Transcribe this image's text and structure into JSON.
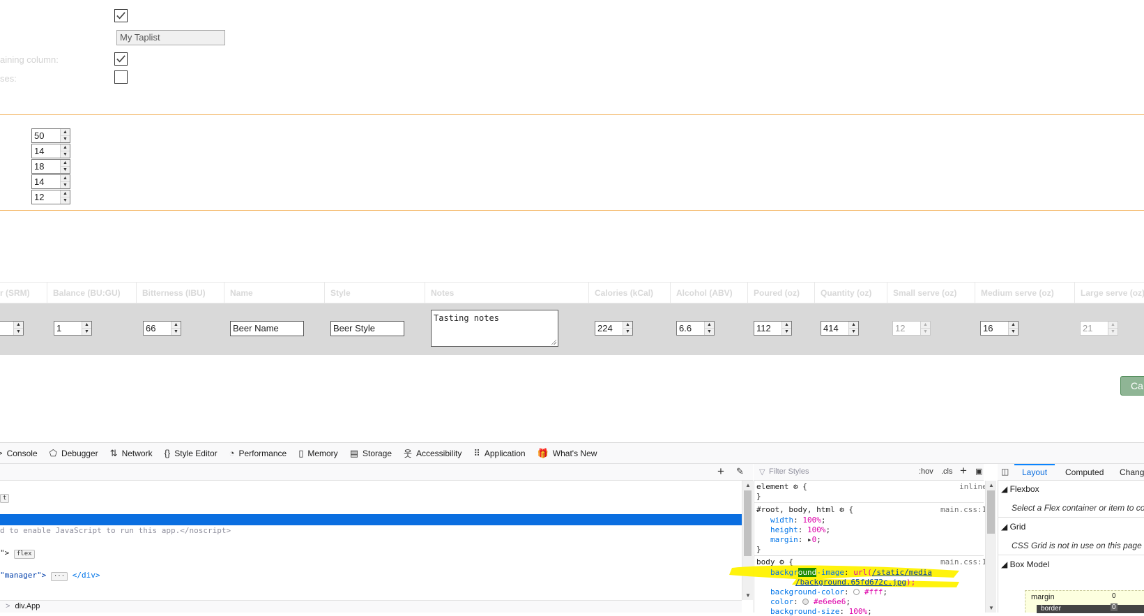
{
  "settings": {
    "taplist_title_value": "My Taplist",
    "remaining_column_label": "aining column:",
    "glasses_label": "ses:"
  },
  "sizes": [
    "50",
    "14",
    "18",
    "14",
    "12"
  ],
  "table": {
    "headers": [
      "r (SRM)",
      "Balance (BU:GU)",
      "Bitterness (IBU)",
      "Name",
      "Style",
      "Notes",
      "Calories (kCal)",
      "Alcohol (ABV)",
      "Poured (oz)",
      "Quantity (oz)",
      "Small serve (oz)",
      "Medium serve (oz)",
      "Large serve (oz)"
    ],
    "row": {
      "srm": "",
      "balance": "1",
      "ibu": "66",
      "name": "Beer Name",
      "style": "Beer Style",
      "notes": "Tasting notes",
      "calories": "224",
      "abv": "6.6",
      "poured": "112",
      "quantity": "414",
      "small_serve": "12",
      "medium_serve": "16",
      "large_serve": "21"
    }
  },
  "cancel_button_label": "Ca",
  "devtools": {
    "tabs": [
      {
        "icon": "console-icon",
        "label": "Console"
      },
      {
        "icon": "debugger-icon",
        "label": "Debugger"
      },
      {
        "icon": "network-icon",
        "label": "Network"
      },
      {
        "icon": "style-editor-icon",
        "label": "Style Editor"
      },
      {
        "icon": "performance-icon",
        "label": "Performance"
      },
      {
        "icon": "memory-icon",
        "label": "Memory"
      },
      {
        "icon": "storage-icon",
        "label": "Storage"
      },
      {
        "icon": "accessibility-icon",
        "label": "Accessibility"
      },
      {
        "icon": "application-icon",
        "label": "Application"
      },
      {
        "icon": "whats-new-icon",
        "label": "What's New"
      }
    ],
    "markup": {
      "line1_badge": "t",
      "noscript": "d to enable JavaScript to run this app.</noscript>",
      "line3": "\">",
      "flex_badge": "flex",
      "line4_attr": "\"manager\">",
      "line4_close": "</div>",
      "breadcrumb_sep": ">",
      "breadcrumb": "div.App"
    },
    "rules": {
      "filter_placeholder": "Filter Styles",
      "hov": ":hov",
      "cls": ".cls",
      "element_selector": "element",
      "element_source": "inline",
      "rule2_selector": "#root, body, html",
      "rule2_source": "main.css:1",
      "width_prop": "width",
      "width_val": "100%",
      "height_prop": "height",
      "height_val": "100%",
      "margin_prop": "margin",
      "margin_val": "0",
      "body_selector": "body",
      "body_source": "main.css:1",
      "bgimg_prop_a": "backgr",
      "bgimg_prop_hl": "ound",
      "bgimg_prop_b": "-image",
      "bgimg_url1": "/static/media",
      "bgimg_url2": "/background.65fd672c.jpg",
      "bgcolor_prop": "background-color",
      "bgcolor_val": "#fff",
      "color_prop": "color",
      "color_val": "#e6e6e6",
      "bgsize_prop": "background-size",
      "bgsize_val": "100%"
    },
    "layout": {
      "tabs": [
        "Layout",
        "Computed",
        "Chang"
      ],
      "flexbox_head": "Flexbox",
      "flexbox_note": "Select a Flex container or item to con",
      "grid_head": "Grid",
      "grid_note": "CSS Grid is not in use on this page",
      "boxmodel_head": "Box Model",
      "margin_label": "margin",
      "margin_value": "0",
      "border_label": "border",
      "border_value": "0"
    }
  },
  "colors": {
    "accent_orange": "#f3b15a",
    "selection_blue": "#0a6ee0",
    "highlight_yellow": "#fff200",
    "cancel_green": "#8fb595"
  }
}
